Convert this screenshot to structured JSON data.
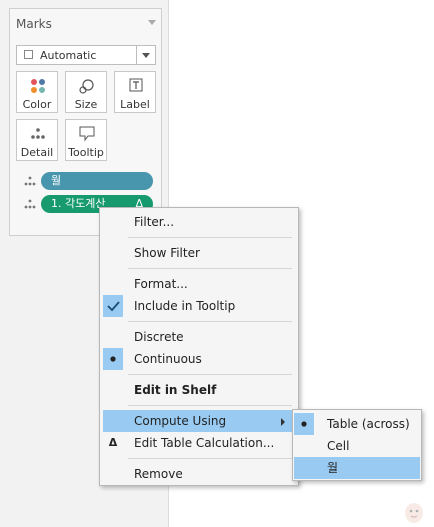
{
  "marks": {
    "title": "Marks",
    "mark_type": "Automatic",
    "buttons": [
      {
        "label": "Color",
        "icon": "color-dots-icon"
      },
      {
        "label": "Size",
        "icon": "size-icon"
      },
      {
        "label": "Label",
        "icon": "label-T-icon"
      },
      {
        "label": "Detail",
        "icon": "detail-dots-icon"
      },
      {
        "label": "Tooltip",
        "icon": "tooltip-bubble-icon"
      }
    ],
    "pills": [
      {
        "label": "월",
        "color": "#4895ae"
      },
      {
        "label": "1. 각도계산",
        "delta": "Δ",
        "color": "#169a6e"
      }
    ]
  },
  "context_menu": {
    "items": {
      "filter": "Filter...",
      "show_filter": "Show Filter",
      "format": "Format...",
      "include_tooltip": "Include in Tooltip",
      "discrete": "Discrete",
      "continuous": "Continuous",
      "edit_in_shelf": "Edit in Shelf",
      "compute_using": "Compute Using",
      "edit_table_calc": "Edit Table Calculation...",
      "remove": "Remove"
    },
    "include_tooltip_checked": true,
    "selected_mode": "Continuous",
    "highlight_color": "#99cbf2"
  },
  "compute_using_submenu": {
    "items": [
      "Table (across)",
      "Cell",
      "월"
    ],
    "selected": "Table (across)",
    "hovered": "월"
  }
}
